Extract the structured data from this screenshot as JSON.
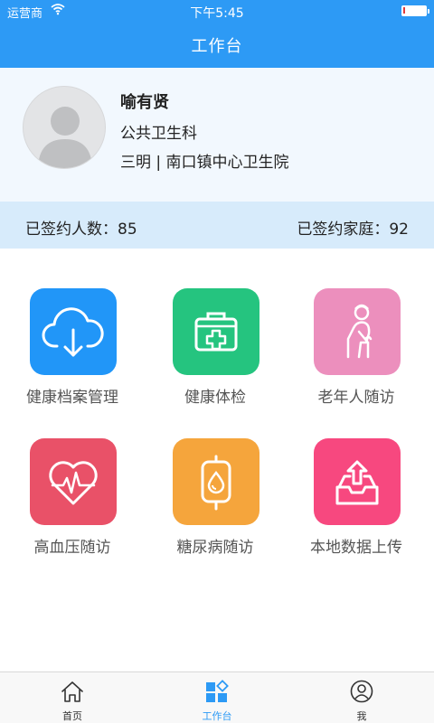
{
  "status_bar": {
    "carrier": "运营商",
    "time": "下午5:45",
    "battery_level": 0.1,
    "battery_color": "#e23b3b"
  },
  "header": {
    "title": "工作台",
    "background": "#2d9af5"
  },
  "profile": {
    "name": "喻有贤",
    "department": "公共卫生科",
    "organization": "三明 | 南口镇中心卫生院",
    "avatar_icon": "user-silhouette-icon"
  },
  "stats": {
    "signed_people_label": "已签约人数：",
    "signed_people_value": "85",
    "signed_families_label": "已签约家庭：",
    "signed_families_value": "92"
  },
  "functions": [
    {
      "label": "健康档案管理",
      "icon": "cloud-download-icon",
      "color": "#2196f8"
    },
    {
      "label": "健康体检",
      "icon": "medical-kit-icon",
      "color": "#25c47f"
    },
    {
      "label": "老年人随访",
      "icon": "elderly-person-icon",
      "color": "#ec8fbd"
    },
    {
      "label": "高血压随访",
      "icon": "heart-pulse-icon",
      "color": "#e95168"
    },
    {
      "label": "糖尿病随访",
      "icon": "iv-drip-bag-icon",
      "color": "#f5a53c"
    },
    {
      "label": "本地数据上传",
      "icon": "inbox-upload-icon",
      "color": "#f7487f"
    }
  ],
  "tabbar": {
    "items": [
      {
        "label": "首页",
        "icon": "home-icon"
      },
      {
        "label": "工作台",
        "icon": "workbench-grid-icon",
        "active": true
      },
      {
        "label": "我",
        "icon": "user-profile-icon"
      }
    ]
  }
}
